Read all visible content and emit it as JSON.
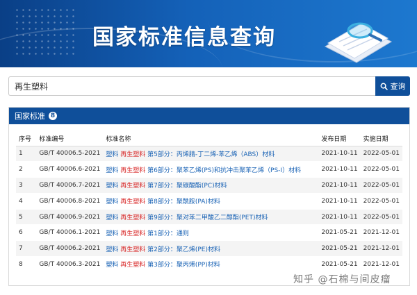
{
  "banner": {
    "title": "国家标准信息查询"
  },
  "search": {
    "value": "再生塑料",
    "button_label": "查询"
  },
  "panel": {
    "title": "国家标准",
    "count": "8"
  },
  "table": {
    "headers": [
      "序号",
      "标准编号",
      "标准名称",
      "发布日期",
      "实施日期"
    ],
    "rows": [
      {
        "idx": "1",
        "code": "GB/T 40006.5-2021",
        "kw1": "塑料",
        "kw2": "再生塑料",
        "part": "第5部分：",
        "rest": "丙烯腈-丁二烯-苯乙烯（ABS）材料",
        "pub": "2021-10-11",
        "impl": "2022-05-01"
      },
      {
        "idx": "2",
        "code": "GB/T 40006.6-2021",
        "kw1": "塑料",
        "kw2": "再生塑料",
        "part": "第6部分：",
        "rest": "聚苯乙烯(PS)和抗冲击聚苯乙烯（PS-I）材料",
        "pub": "2021-10-11",
        "impl": "2022-05-01"
      },
      {
        "idx": "3",
        "code": "GB/T 40006.7-2021",
        "kw1": "塑料",
        "kw2": "再生塑料",
        "part": "第7部分：",
        "rest": "聚碳酸酯(PC)材料",
        "pub": "2021-10-11",
        "impl": "2022-05-01"
      },
      {
        "idx": "4",
        "code": "GB/T 40006.8-2021",
        "kw1": "塑料",
        "kw2": "再生塑料",
        "part": "第8部分：",
        "rest": "聚酰胺(PA)材料",
        "pub": "2021-10-11",
        "impl": "2022-05-01"
      },
      {
        "idx": "5",
        "code": "GB/T 40006.9-2021",
        "kw1": "塑料",
        "kw2": "再生塑料",
        "part": "第9部分：",
        "rest": "聚对苯二甲酸乙二醇酯(PET)材料",
        "pub": "2021-10-11",
        "impl": "2022-05-01"
      },
      {
        "idx": "6",
        "code": "GB/T 40006.1-2021",
        "kw1": "塑料",
        "kw2": "再生塑料",
        "part": "第1部分：",
        "rest": "通则",
        "pub": "2021-05-21",
        "impl": "2021-12-01"
      },
      {
        "idx": "7",
        "code": "GB/T 40006.2-2021",
        "kw1": "塑料",
        "kw2": "再生塑料",
        "part": "第2部分：",
        "rest": "聚乙烯(PE)材料",
        "pub": "2021-05-21",
        "impl": "2021-12-01"
      },
      {
        "idx": "8",
        "code": "GB/T 40006.3-2021",
        "kw1": "塑料",
        "kw2": "再生塑料",
        "part": "第3部分：",
        "rest": "聚丙烯(PP)材料",
        "pub": "2021-05-21",
        "impl": "2021-12-01"
      }
    ]
  },
  "watermark": "知乎 @石棉与间皮瘤",
  "colors": {
    "primary": "#0f4f9a",
    "link": "#1a63b5",
    "highlight": "#d92b2b"
  },
  "icons": {
    "search": "search-icon",
    "document": "document-magnifier-icon"
  }
}
